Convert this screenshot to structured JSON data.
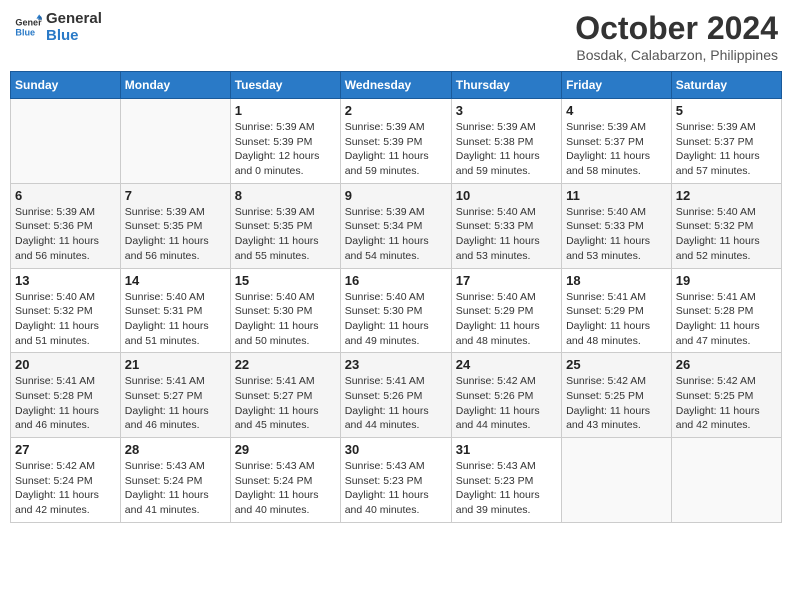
{
  "header": {
    "logo_line1": "General",
    "logo_line2": "Blue",
    "month": "October 2024",
    "location": "Bosdak, Calabarzon, Philippines"
  },
  "weekdays": [
    "Sunday",
    "Monday",
    "Tuesday",
    "Wednesday",
    "Thursday",
    "Friday",
    "Saturday"
  ],
  "weeks": [
    [
      {
        "day": "",
        "info": ""
      },
      {
        "day": "",
        "info": ""
      },
      {
        "day": "1",
        "info": "Sunrise: 5:39 AM\nSunset: 5:39 PM\nDaylight: 12 hours\nand 0 minutes."
      },
      {
        "day": "2",
        "info": "Sunrise: 5:39 AM\nSunset: 5:39 PM\nDaylight: 11 hours\nand 59 minutes."
      },
      {
        "day": "3",
        "info": "Sunrise: 5:39 AM\nSunset: 5:38 PM\nDaylight: 11 hours\nand 59 minutes."
      },
      {
        "day": "4",
        "info": "Sunrise: 5:39 AM\nSunset: 5:37 PM\nDaylight: 11 hours\nand 58 minutes."
      },
      {
        "day": "5",
        "info": "Sunrise: 5:39 AM\nSunset: 5:37 PM\nDaylight: 11 hours\nand 57 minutes."
      }
    ],
    [
      {
        "day": "6",
        "info": "Sunrise: 5:39 AM\nSunset: 5:36 PM\nDaylight: 11 hours\nand 56 minutes."
      },
      {
        "day": "7",
        "info": "Sunrise: 5:39 AM\nSunset: 5:35 PM\nDaylight: 11 hours\nand 56 minutes."
      },
      {
        "day": "8",
        "info": "Sunrise: 5:39 AM\nSunset: 5:35 PM\nDaylight: 11 hours\nand 55 minutes."
      },
      {
        "day": "9",
        "info": "Sunrise: 5:39 AM\nSunset: 5:34 PM\nDaylight: 11 hours\nand 54 minutes."
      },
      {
        "day": "10",
        "info": "Sunrise: 5:40 AM\nSunset: 5:33 PM\nDaylight: 11 hours\nand 53 minutes."
      },
      {
        "day": "11",
        "info": "Sunrise: 5:40 AM\nSunset: 5:33 PM\nDaylight: 11 hours\nand 53 minutes."
      },
      {
        "day": "12",
        "info": "Sunrise: 5:40 AM\nSunset: 5:32 PM\nDaylight: 11 hours\nand 52 minutes."
      }
    ],
    [
      {
        "day": "13",
        "info": "Sunrise: 5:40 AM\nSunset: 5:32 PM\nDaylight: 11 hours\nand 51 minutes."
      },
      {
        "day": "14",
        "info": "Sunrise: 5:40 AM\nSunset: 5:31 PM\nDaylight: 11 hours\nand 51 minutes."
      },
      {
        "day": "15",
        "info": "Sunrise: 5:40 AM\nSunset: 5:30 PM\nDaylight: 11 hours\nand 50 minutes."
      },
      {
        "day": "16",
        "info": "Sunrise: 5:40 AM\nSunset: 5:30 PM\nDaylight: 11 hours\nand 49 minutes."
      },
      {
        "day": "17",
        "info": "Sunrise: 5:40 AM\nSunset: 5:29 PM\nDaylight: 11 hours\nand 48 minutes."
      },
      {
        "day": "18",
        "info": "Sunrise: 5:41 AM\nSunset: 5:29 PM\nDaylight: 11 hours\nand 48 minutes."
      },
      {
        "day": "19",
        "info": "Sunrise: 5:41 AM\nSunset: 5:28 PM\nDaylight: 11 hours\nand 47 minutes."
      }
    ],
    [
      {
        "day": "20",
        "info": "Sunrise: 5:41 AM\nSunset: 5:28 PM\nDaylight: 11 hours\nand 46 minutes."
      },
      {
        "day": "21",
        "info": "Sunrise: 5:41 AM\nSunset: 5:27 PM\nDaylight: 11 hours\nand 46 minutes."
      },
      {
        "day": "22",
        "info": "Sunrise: 5:41 AM\nSunset: 5:27 PM\nDaylight: 11 hours\nand 45 minutes."
      },
      {
        "day": "23",
        "info": "Sunrise: 5:41 AM\nSunset: 5:26 PM\nDaylight: 11 hours\nand 44 minutes."
      },
      {
        "day": "24",
        "info": "Sunrise: 5:42 AM\nSunset: 5:26 PM\nDaylight: 11 hours\nand 44 minutes."
      },
      {
        "day": "25",
        "info": "Sunrise: 5:42 AM\nSunset: 5:25 PM\nDaylight: 11 hours\nand 43 minutes."
      },
      {
        "day": "26",
        "info": "Sunrise: 5:42 AM\nSunset: 5:25 PM\nDaylight: 11 hours\nand 42 minutes."
      }
    ],
    [
      {
        "day": "27",
        "info": "Sunrise: 5:42 AM\nSunset: 5:24 PM\nDaylight: 11 hours\nand 42 minutes."
      },
      {
        "day": "28",
        "info": "Sunrise: 5:43 AM\nSunset: 5:24 PM\nDaylight: 11 hours\nand 41 minutes."
      },
      {
        "day": "29",
        "info": "Sunrise: 5:43 AM\nSunset: 5:24 PM\nDaylight: 11 hours\nand 40 minutes."
      },
      {
        "day": "30",
        "info": "Sunrise: 5:43 AM\nSunset: 5:23 PM\nDaylight: 11 hours\nand 40 minutes."
      },
      {
        "day": "31",
        "info": "Sunrise: 5:43 AM\nSunset: 5:23 PM\nDaylight: 11 hours\nand 39 minutes."
      },
      {
        "day": "",
        "info": ""
      },
      {
        "day": "",
        "info": ""
      }
    ]
  ]
}
